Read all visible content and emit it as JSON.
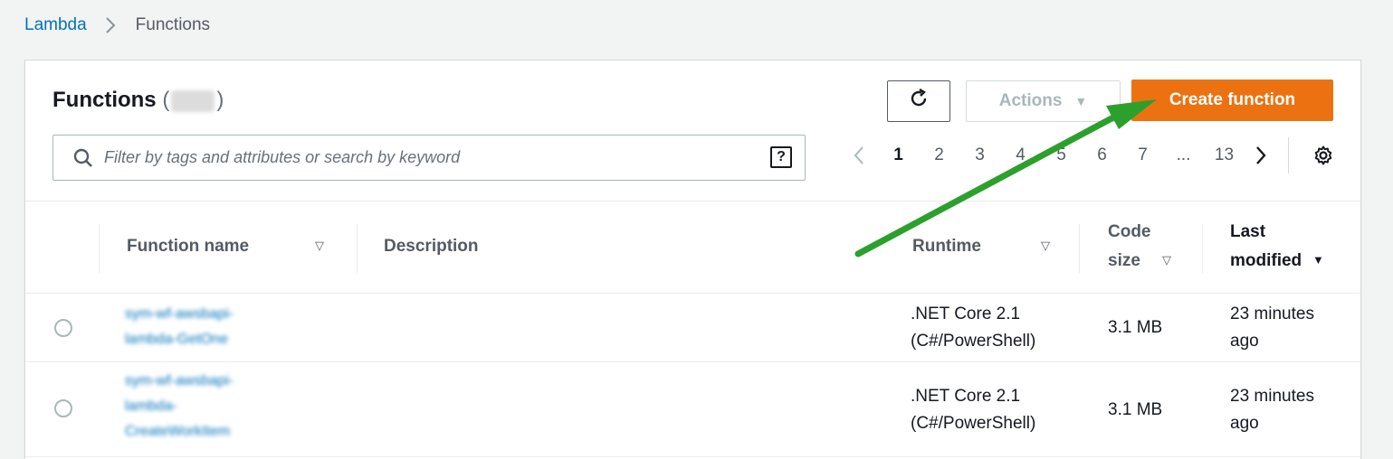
{
  "breadcrumb": {
    "parent": "Lambda",
    "current": "Functions"
  },
  "panel": {
    "title": "Functions",
    "count_open": "(",
    "count_close": ")"
  },
  "toolbar": {
    "refresh_icon": "refresh-icon",
    "actions_label": "Actions",
    "create_label": "Create function"
  },
  "search": {
    "placeholder": "Filter by tags and attributes or search by keyword",
    "help": "?"
  },
  "pagination": {
    "pages": [
      "1",
      "2",
      "3",
      "4",
      "5",
      "6",
      "7"
    ],
    "ellipsis": "...",
    "last": "13",
    "current": "1"
  },
  "table": {
    "columns": {
      "function_name": "Function name",
      "description": "Description",
      "runtime": "Runtime",
      "code_size_1": "Code",
      "code_size_2": "size",
      "last_modified_1": "Last",
      "last_modified_2": "modified"
    },
    "rows": [
      {
        "name_lines": [
          "sym-wf-awsbapi-",
          "lambda-GetOne"
        ],
        "description": "",
        "runtime_1": ".NET Core 2.1",
        "runtime_2": "(C#/PowerShell)",
        "code_size": "3.1 MB",
        "modified_1": "23 minutes",
        "modified_2": "ago"
      },
      {
        "name_lines": [
          "sym-wf-awsbapi-",
          "lambda-",
          "CreateWorkItem"
        ],
        "description": "",
        "runtime_1": ".NET Core 2.1",
        "runtime_2": "(C#/PowerShell)",
        "code_size": "3.1 MB",
        "modified_1": "23 minutes",
        "modified_2": "ago"
      }
    ]
  },
  "colors": {
    "link": "#0073bb",
    "primary": "#ec7211",
    "annotation_arrow": "#2ca02c"
  }
}
